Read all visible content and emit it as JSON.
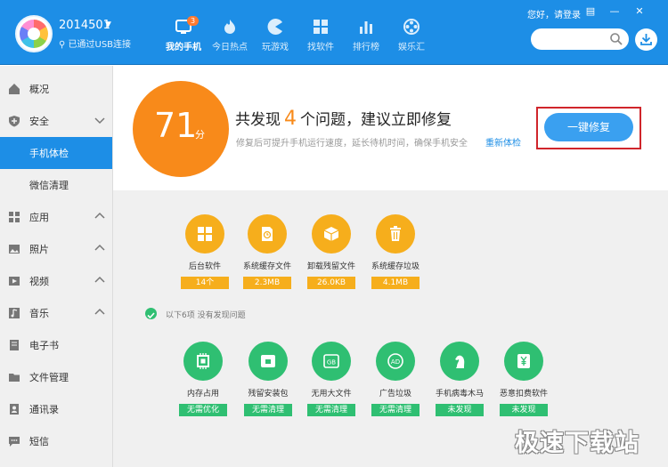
{
  "header": {
    "device_name": "2014501",
    "device_status": "已通过USB连接",
    "greeting": "您好，请登录",
    "search_placeholder": "",
    "nav": [
      {
        "label": "我的手机",
        "badge": "3"
      },
      {
        "label": "今日热点"
      },
      {
        "label": "玩游戏"
      },
      {
        "label": "找软件"
      },
      {
        "label": "排行榜"
      },
      {
        "label": "娱乐汇"
      }
    ]
  },
  "sidebar": {
    "items": [
      {
        "label": "概况"
      },
      {
        "label": "安全"
      },
      {
        "label": "手机体检"
      },
      {
        "label": "微信清理"
      },
      {
        "label": "应用"
      },
      {
        "label": "照片"
      },
      {
        "label": "视频"
      },
      {
        "label": "音乐"
      },
      {
        "label": "电子书"
      },
      {
        "label": "文件管理"
      },
      {
        "label": "通讯录"
      },
      {
        "label": "短信"
      }
    ]
  },
  "summary": {
    "score": "71",
    "score_unit": "分",
    "headline_prefix": "共发现",
    "issue_count": "4",
    "headline_suffix": "个问题，建议立即修复",
    "subtext": "修复后可提升手机运行速度，延长待机时间，确保手机安全",
    "recheck_label": "重新体检",
    "fix_button": "一键修复"
  },
  "problems": [
    {
      "label": "后台软件",
      "value": "14个"
    },
    {
      "label": "系统缓存文件",
      "value": "2.3MB"
    },
    {
      "label": "卸载残留文件",
      "value": "26.0KB"
    },
    {
      "label": "系统缓存垃圾",
      "value": "4.1MB"
    }
  ],
  "ok_text": "以下6项 没有发现问题",
  "ok_items": [
    {
      "label": "内存占用",
      "value": "无需优化"
    },
    {
      "label": "残留安装包",
      "value": "无需清理"
    },
    {
      "label": "无用大文件",
      "value": "无需清理"
    },
    {
      "label": "广告垃圾",
      "value": "无需清理"
    },
    {
      "label": "手机病毒木马",
      "value": "未发现"
    },
    {
      "label": "恶意扣费软件",
      "value": "未发现"
    }
  ],
  "watermark": "极速下载站",
  "colors": {
    "primary": "#1d8ee6",
    "orange": "#f88a1a",
    "warn": "#f6ae1c",
    "ok": "#2fbf72",
    "highlight": "#d0252b"
  }
}
